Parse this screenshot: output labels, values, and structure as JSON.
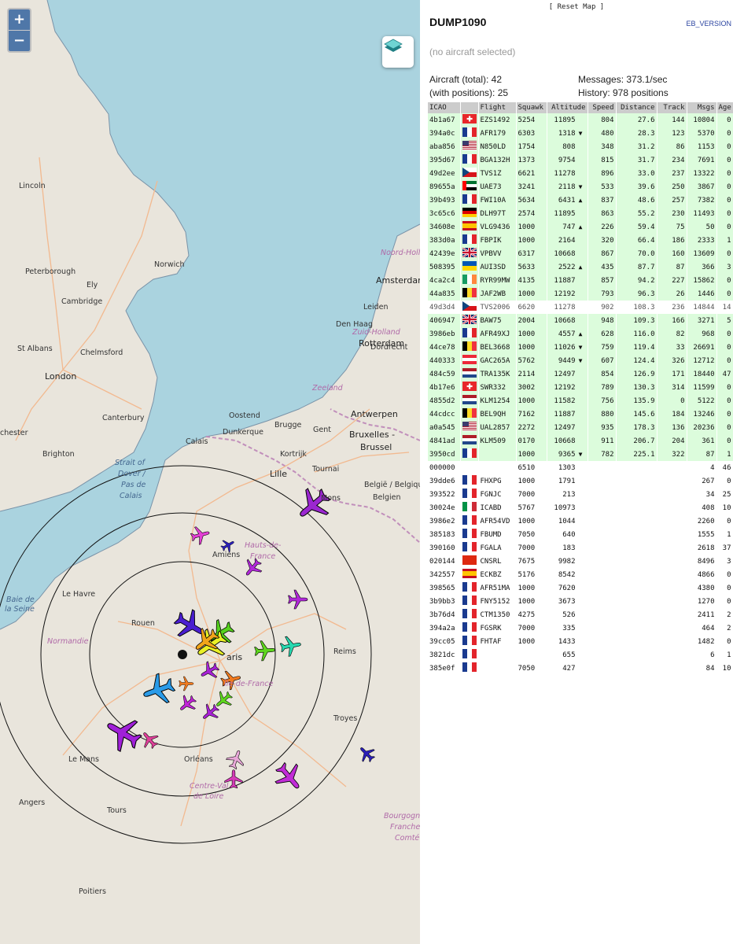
{
  "map": {
    "zoom_in": "+",
    "zoom_out": "−",
    "labels": {
      "lincoln": "Lincoln",
      "norwich": "Norwich",
      "peterborough": "Peterborough",
      "ely": "Ely",
      "cambridge": "Cambridge",
      "st_albans": "St Albans",
      "chelmsford": "Chelmsford",
      "london": "London",
      "canterbury": "Canterbury",
      "brighton": "Brighton",
      "chester": "chester",
      "noord_holland": "Noord-Holla",
      "amsterdam": "Amsterdam",
      "leiden": "Leiden",
      "den_haag": "Den Haag",
      "zuid_holland": "Zuid-Holland",
      "rotterdam": "Rotterdam",
      "dordrecht": "Dordrecht",
      "zeeland": "Zeeland",
      "oostend": "Oostend",
      "brugge": "Brugge",
      "gent": "Gent",
      "antwerpen": "Antwerpen",
      "bruxelles1": "Bruxelles -",
      "bruxelles2": "Brussel",
      "dunkerque": "Dunkerque",
      "calais": "Calais",
      "kortrijk": "Kortrijk",
      "tournai": "Tournai",
      "lille": "Lille",
      "mons": "Mons",
      "belgique1": "België / Belgique",
      "belgique2": "Belgien",
      "strait1": "Strait of",
      "strait2": "Dover /",
      "strait3": "Pas de",
      "strait4": "Calais",
      "amiens": "Amiens",
      "hauts1": "Hauts-de-",
      "hauts2": "France",
      "le_havre": "Le Havre",
      "baie1": "Baie de",
      "baie2": "la Seine",
      "normandie": "Normandie",
      "rouen": "Rouen",
      "reims": "Reims",
      "paris": "aris",
      "ile": "Île-de-France",
      "troyes": "Troyes",
      "le_mans": "Le Mans",
      "orleans": "Orléans",
      "centre1": "Centre-Val",
      "centre2": "de Loire",
      "angers": "Angers",
      "tours": "Tours",
      "bourgogne1": "Bourgogne-",
      "bourgogne2": "Franche-",
      "bourgogne3": "Comté",
      "poitiers": "Poitiers"
    }
  },
  "panel": {
    "reset_map": "[ Reset Map ]",
    "title": "DUMP1090",
    "version": "EB_VERSION",
    "no_selection": "(no aircraft selected)",
    "stats": {
      "aircraft_total": "Aircraft (total): 42",
      "with_positions": "(with positions): 25",
      "messages": "Messages: 373.1/sec",
      "history": "History: 978 positions"
    },
    "columns": [
      "ICAO",
      "",
      "Flight",
      "Squawk",
      "Altitude",
      "Speed",
      "Distance",
      "Track",
      "Msgs",
      "Age"
    ],
    "flag_colors": {
      "CH": [
        "#e8262b",
        "#ffffff"
      ],
      "FR": [
        "#1a3a8f",
        "#ffffff",
        "#e3242b"
      ],
      "US": [
        "#b22234",
        "#ffffff",
        "#3c3b6e"
      ],
      "CZ": [
        "#ffffff",
        "#d7141a",
        "#11457e"
      ],
      "AE": [
        "#00732f",
        "#ffffff",
        "#000000",
        "#ff0000"
      ],
      "DE": [
        "#000000",
        "#dd0000",
        "#ffce00"
      ],
      "ES": [
        "#c60b1e",
        "#ffc400"
      ],
      "GB": [
        "#012169",
        "#ffffff",
        "#c8102e"
      ],
      "UA": [
        "#0057b7",
        "#ffd700"
      ],
      "IE": [
        "#169b62",
        "#ffffff",
        "#ff883e"
      ],
      "BE": [
        "#000000",
        "#fdda24",
        "#ef3340"
      ],
      "AT": [
        "#ed2939",
        "#ffffff"
      ],
      "NL": [
        "#ae1c28",
        "#ffffff",
        "#21468b"
      ],
      "IT": [
        "#009246",
        "#ffffff",
        "#ce2b37"
      ],
      "CN": [
        "#de2910",
        "#ffde00"
      ]
    },
    "rows": [
      {
        "icao": "4b1a67",
        "flag": "CH",
        "flight": "EZS1492",
        "squawk": "5254",
        "altitude": "11895",
        "trend": "",
        "speed": "804",
        "distance": "27.6",
        "track": "144",
        "msgs": "10804",
        "age": "0",
        "pos": true
      },
      {
        "icao": "394a0c",
        "flag": "FR",
        "flight": "AFR179",
        "squawk": "6303",
        "altitude": "1318",
        "trend": "▼",
        "speed": "480",
        "distance": "28.3",
        "track": "123",
        "msgs": "5370",
        "age": "0",
        "pos": true
      },
      {
        "icao": "aba856",
        "flag": "US",
        "flight": "N850LD",
        "squawk": "1754",
        "altitude": "808",
        "trend": "",
        "speed": "348",
        "distance": "31.2",
        "track": "86",
        "msgs": "1153",
        "age": "0",
        "pos": true
      },
      {
        "icao": "395d67",
        "flag": "FR",
        "flight": "BGA132H",
        "squawk": "1373",
        "altitude": "9754",
        "trend": "",
        "speed": "815",
        "distance": "31.7",
        "track": "234",
        "msgs": "7691",
        "age": "0",
        "pos": true
      },
      {
        "icao": "49d2ee",
        "flag": "CZ",
        "flight": "TVS1Z",
        "squawk": "6621",
        "altitude": "11278",
        "trend": "",
        "speed": "896",
        "distance": "33.0",
        "track": "237",
        "msgs": "13322",
        "age": "0",
        "pos": true
      },
      {
        "icao": "89655a",
        "flag": "AE",
        "flight": "UAE73",
        "squawk": "3241",
        "altitude": "2118",
        "trend": "▼",
        "speed": "533",
        "distance": "39.6",
        "track": "250",
        "msgs": "3867",
        "age": "0",
        "pos": true
      },
      {
        "icao": "39b493",
        "flag": "FR",
        "flight": "FWI10A",
        "squawk": "5634",
        "altitude": "6431",
        "trend": "▲",
        "speed": "837",
        "distance": "48.6",
        "track": "257",
        "msgs": "7382",
        "age": "0",
        "pos": true
      },
      {
        "icao": "3c65c6",
        "flag": "DE",
        "flight": "DLH97T",
        "squawk": "2574",
        "altitude": "11895",
        "trend": "",
        "speed": "863",
        "distance": "55.2",
        "track": "230",
        "msgs": "11493",
        "age": "0",
        "pos": true
      },
      {
        "icao": "34608e",
        "flag": "ES",
        "flight": "VLG9436",
        "squawk": "1000",
        "altitude": "747",
        "trend": "▲",
        "speed": "226",
        "distance": "59.4",
        "track": "75",
        "msgs": "50",
        "age": "0",
        "pos": true
      },
      {
        "icao": "383d0a",
        "flag": "FR",
        "flight": "FBPIK",
        "squawk": "1000",
        "altitude": "2164",
        "trend": "",
        "speed": "320",
        "distance": "66.4",
        "track": "186",
        "msgs": "2333",
        "age": "1",
        "pos": true
      },
      {
        "icao": "42439e",
        "flag": "GB",
        "flight": "VPBVV",
        "squawk": "6317",
        "altitude": "10668",
        "trend": "",
        "speed": "867",
        "distance": "70.0",
        "track": "160",
        "msgs": "13609",
        "age": "0",
        "pos": true
      },
      {
        "icao": "508395",
        "flag": "UA",
        "flight": "AUI3SD",
        "squawk": "5633",
        "altitude": "2522",
        "trend": "▲",
        "speed": "435",
        "distance": "87.7",
        "track": "87",
        "msgs": "366",
        "age": "3",
        "pos": true
      },
      {
        "icao": "4ca2c4",
        "flag": "IE",
        "flight": "RYR99MW",
        "squawk": "4135",
        "altitude": "11887",
        "trend": "",
        "speed": "857",
        "distance": "94.2",
        "track": "227",
        "msgs": "15862",
        "age": "0",
        "pos": true
      },
      {
        "icao": "44a835",
        "flag": "BE",
        "flight": "JAF2WB",
        "squawk": "1000",
        "altitude": "12192",
        "trend": "",
        "speed": "793",
        "distance": "96.3",
        "track": "26",
        "msgs": "1446",
        "age": "0",
        "pos": true
      },
      {
        "icao": "49d3d4",
        "flag": "CZ",
        "flight": "TVS2006",
        "squawk": "6620",
        "altitude": "11278",
        "trend": "",
        "speed": "902",
        "distance": "108.3",
        "track": "236",
        "msgs": "14844",
        "age": "14",
        "pos": false,
        "dim": true
      },
      {
        "icao": "406947",
        "flag": "GB",
        "flight": "BAW75",
        "squawk": "2004",
        "altitude": "10668",
        "trend": "",
        "speed": "948",
        "distance": "109.3",
        "track": "166",
        "msgs": "3271",
        "age": "5",
        "pos": true
      },
      {
        "icao": "3986eb",
        "flag": "FR",
        "flight": "AFR49XJ",
        "squawk": "1000",
        "altitude": "4557",
        "trend": "▲",
        "speed": "628",
        "distance": "116.0",
        "track": "82",
        "msgs": "968",
        "age": "0",
        "pos": true
      },
      {
        "icao": "44ce78",
        "flag": "BE",
        "flight": "BEL3668",
        "squawk": "1000",
        "altitude": "11026",
        "trend": "▼",
        "speed": "759",
        "distance": "119.4",
        "track": "33",
        "msgs": "26691",
        "age": "0",
        "pos": true
      },
      {
        "icao": "440333",
        "flag": "AT",
        "flight": "GAC265A",
        "squawk": "5762",
        "altitude": "9449",
        "trend": "▼",
        "speed": "607",
        "distance": "124.4",
        "track": "326",
        "msgs": "12712",
        "age": "0",
        "pos": true
      },
      {
        "icao": "484c59",
        "flag": "NL",
        "flight": "TRA135K",
        "squawk": "2114",
        "altitude": "12497",
        "trend": "",
        "speed": "854",
        "distance": "126.9",
        "track": "171",
        "msgs": "18440",
        "age": "47",
        "pos": true
      },
      {
        "icao": "4b17e6",
        "flag": "CH",
        "flight": "SWR332",
        "squawk": "3002",
        "altitude": "12192",
        "trend": "",
        "speed": "789",
        "distance": "130.3",
        "track": "314",
        "msgs": "11599",
        "age": "0",
        "pos": true
      },
      {
        "icao": "4855d2",
        "flag": "NL",
        "flight": "KLM1254",
        "squawk": "1000",
        "altitude": "11582",
        "trend": "",
        "speed": "756",
        "distance": "135.9",
        "track": "0",
        "msgs": "5122",
        "age": "0",
        "pos": true
      },
      {
        "icao": "44cdcc",
        "flag": "BE",
        "flight": "BEL9QH",
        "squawk": "7162",
        "altitude": "11887",
        "trend": "",
        "speed": "880",
        "distance": "145.6",
        "track": "184",
        "msgs": "13246",
        "age": "0",
        "pos": true
      },
      {
        "icao": "a0a545",
        "flag": "US",
        "flight": "UAL2857",
        "squawk": "2272",
        "altitude": "12497",
        "trend": "",
        "speed": "935",
        "distance": "178.3",
        "track": "136",
        "msgs": "20236",
        "age": "0",
        "pos": true
      },
      {
        "icao": "4841ad",
        "flag": "NL",
        "flight": "KLM509",
        "squawk": "0170",
        "altitude": "10668",
        "trend": "",
        "speed": "911",
        "distance": "206.7",
        "track": "204",
        "msgs": "361",
        "age": "0",
        "pos": true
      },
      {
        "icao": "3950cd",
        "flag": "FR",
        "flight": "",
        "squawk": "1000",
        "altitude": "9365",
        "trend": "▼",
        "speed": "782",
        "distance": "225.1",
        "track": "322",
        "msgs": "87",
        "age": "1",
        "pos": true
      },
      {
        "icao": "000000",
        "flag": "",
        "flight": "",
        "squawk": "6510",
        "altitude": "1303",
        "trend": "",
        "speed": "",
        "distance": "",
        "track": "",
        "msgs": "4",
        "age": "46",
        "pos": false
      },
      {
        "icao": "39dde6",
        "flag": "FR",
        "flight": "FHXPG",
        "squawk": "1000",
        "altitude": "1791",
        "trend": "",
        "speed": "",
        "distance": "",
        "track": "",
        "msgs": "267",
        "age": "0",
        "pos": false
      },
      {
        "icao": "393522",
        "flag": "FR",
        "flight": "FGNJC",
        "squawk": "7000",
        "altitude": "213",
        "trend": "",
        "speed": "",
        "distance": "",
        "track": "",
        "msgs": "34",
        "age": "25",
        "pos": false
      },
      {
        "icao": "30024e",
        "flag": "IT",
        "flight": "ICABD",
        "squawk": "5767",
        "altitude": "10973",
        "trend": "",
        "speed": "",
        "distance": "",
        "track": "",
        "msgs": "408",
        "age": "10",
        "pos": false
      },
      {
        "icao": "3986e2",
        "flag": "FR",
        "flight": "AFR54VD",
        "squawk": "1000",
        "altitude": "1044",
        "trend": "",
        "speed": "",
        "distance": "",
        "track": "",
        "msgs": "2260",
        "age": "0",
        "pos": false
      },
      {
        "icao": "385183",
        "flag": "FR",
        "flight": "FBUMD",
        "squawk": "7050",
        "altitude": "640",
        "trend": "",
        "speed": "",
        "distance": "",
        "track": "",
        "msgs": "1555",
        "age": "1",
        "pos": false
      },
      {
        "icao": "390160",
        "flag": "FR",
        "flight": "FGALA",
        "squawk": "7000",
        "altitude": "183",
        "trend": "",
        "speed": "",
        "distance": "",
        "track": "",
        "msgs": "2618",
        "age": "37",
        "pos": false
      },
      {
        "icao": "020144",
        "flag": "CN",
        "flight": "CNSRL",
        "squawk": "7675",
        "altitude": "9982",
        "trend": "",
        "speed": "",
        "distance": "",
        "track": "",
        "msgs": "8496",
        "age": "3",
        "pos": false
      },
      {
        "icao": "342557",
        "flag": "ES",
        "flight": "ECKBZ",
        "squawk": "5176",
        "altitude": "8542",
        "trend": "",
        "speed": "",
        "distance": "",
        "track": "",
        "msgs": "4866",
        "age": "0",
        "pos": false
      },
      {
        "icao": "398565",
        "flag": "FR",
        "flight": "AFR51MA",
        "squawk": "1000",
        "altitude": "7620",
        "trend": "",
        "speed": "",
        "distance": "",
        "track": "",
        "msgs": "4380",
        "age": "0",
        "pos": false
      },
      {
        "icao": "3b9bb3",
        "flag": "FR",
        "flight": "FNY5152",
        "squawk": "1000",
        "altitude": "3673",
        "trend": "",
        "speed": "",
        "distance": "",
        "track": "",
        "msgs": "1270",
        "age": "0",
        "pos": false
      },
      {
        "icao": "3b76d4",
        "flag": "FR",
        "flight": "CTM1350",
        "squawk": "4275",
        "altitude": "526",
        "trend": "",
        "speed": "",
        "distance": "",
        "track": "",
        "msgs": "2411",
        "age": "2",
        "pos": false
      },
      {
        "icao": "394a2a",
        "flag": "FR",
        "flight": "FGSRK",
        "squawk": "7000",
        "altitude": "335",
        "trend": "",
        "speed": "",
        "distance": "",
        "track": "",
        "msgs": "464",
        "age": "2",
        "pos": false
      },
      {
        "icao": "39cc05",
        "flag": "FR",
        "flight": "FHTAF",
        "squawk": "1000",
        "altitude": "1433",
        "trend": "",
        "speed": "",
        "distance": "",
        "track": "",
        "msgs": "1482",
        "age": "0",
        "pos": false
      },
      {
        "icao": "3821dc",
        "flag": "FR",
        "flight": "",
        "squawk": "",
        "altitude": "655",
        "trend": "",
        "speed": "",
        "distance": "",
        "track": "",
        "msgs": "6",
        "age": "1",
        "pos": false
      },
      {
        "icao": "385e0f",
        "flag": "FR",
        "flight": "",
        "squawk": "7050",
        "altitude": "427",
        "trend": "",
        "speed": "",
        "distance": "",
        "track": "",
        "msgs": "84",
        "age": "10",
        "pos": false
      }
    ]
  }
}
